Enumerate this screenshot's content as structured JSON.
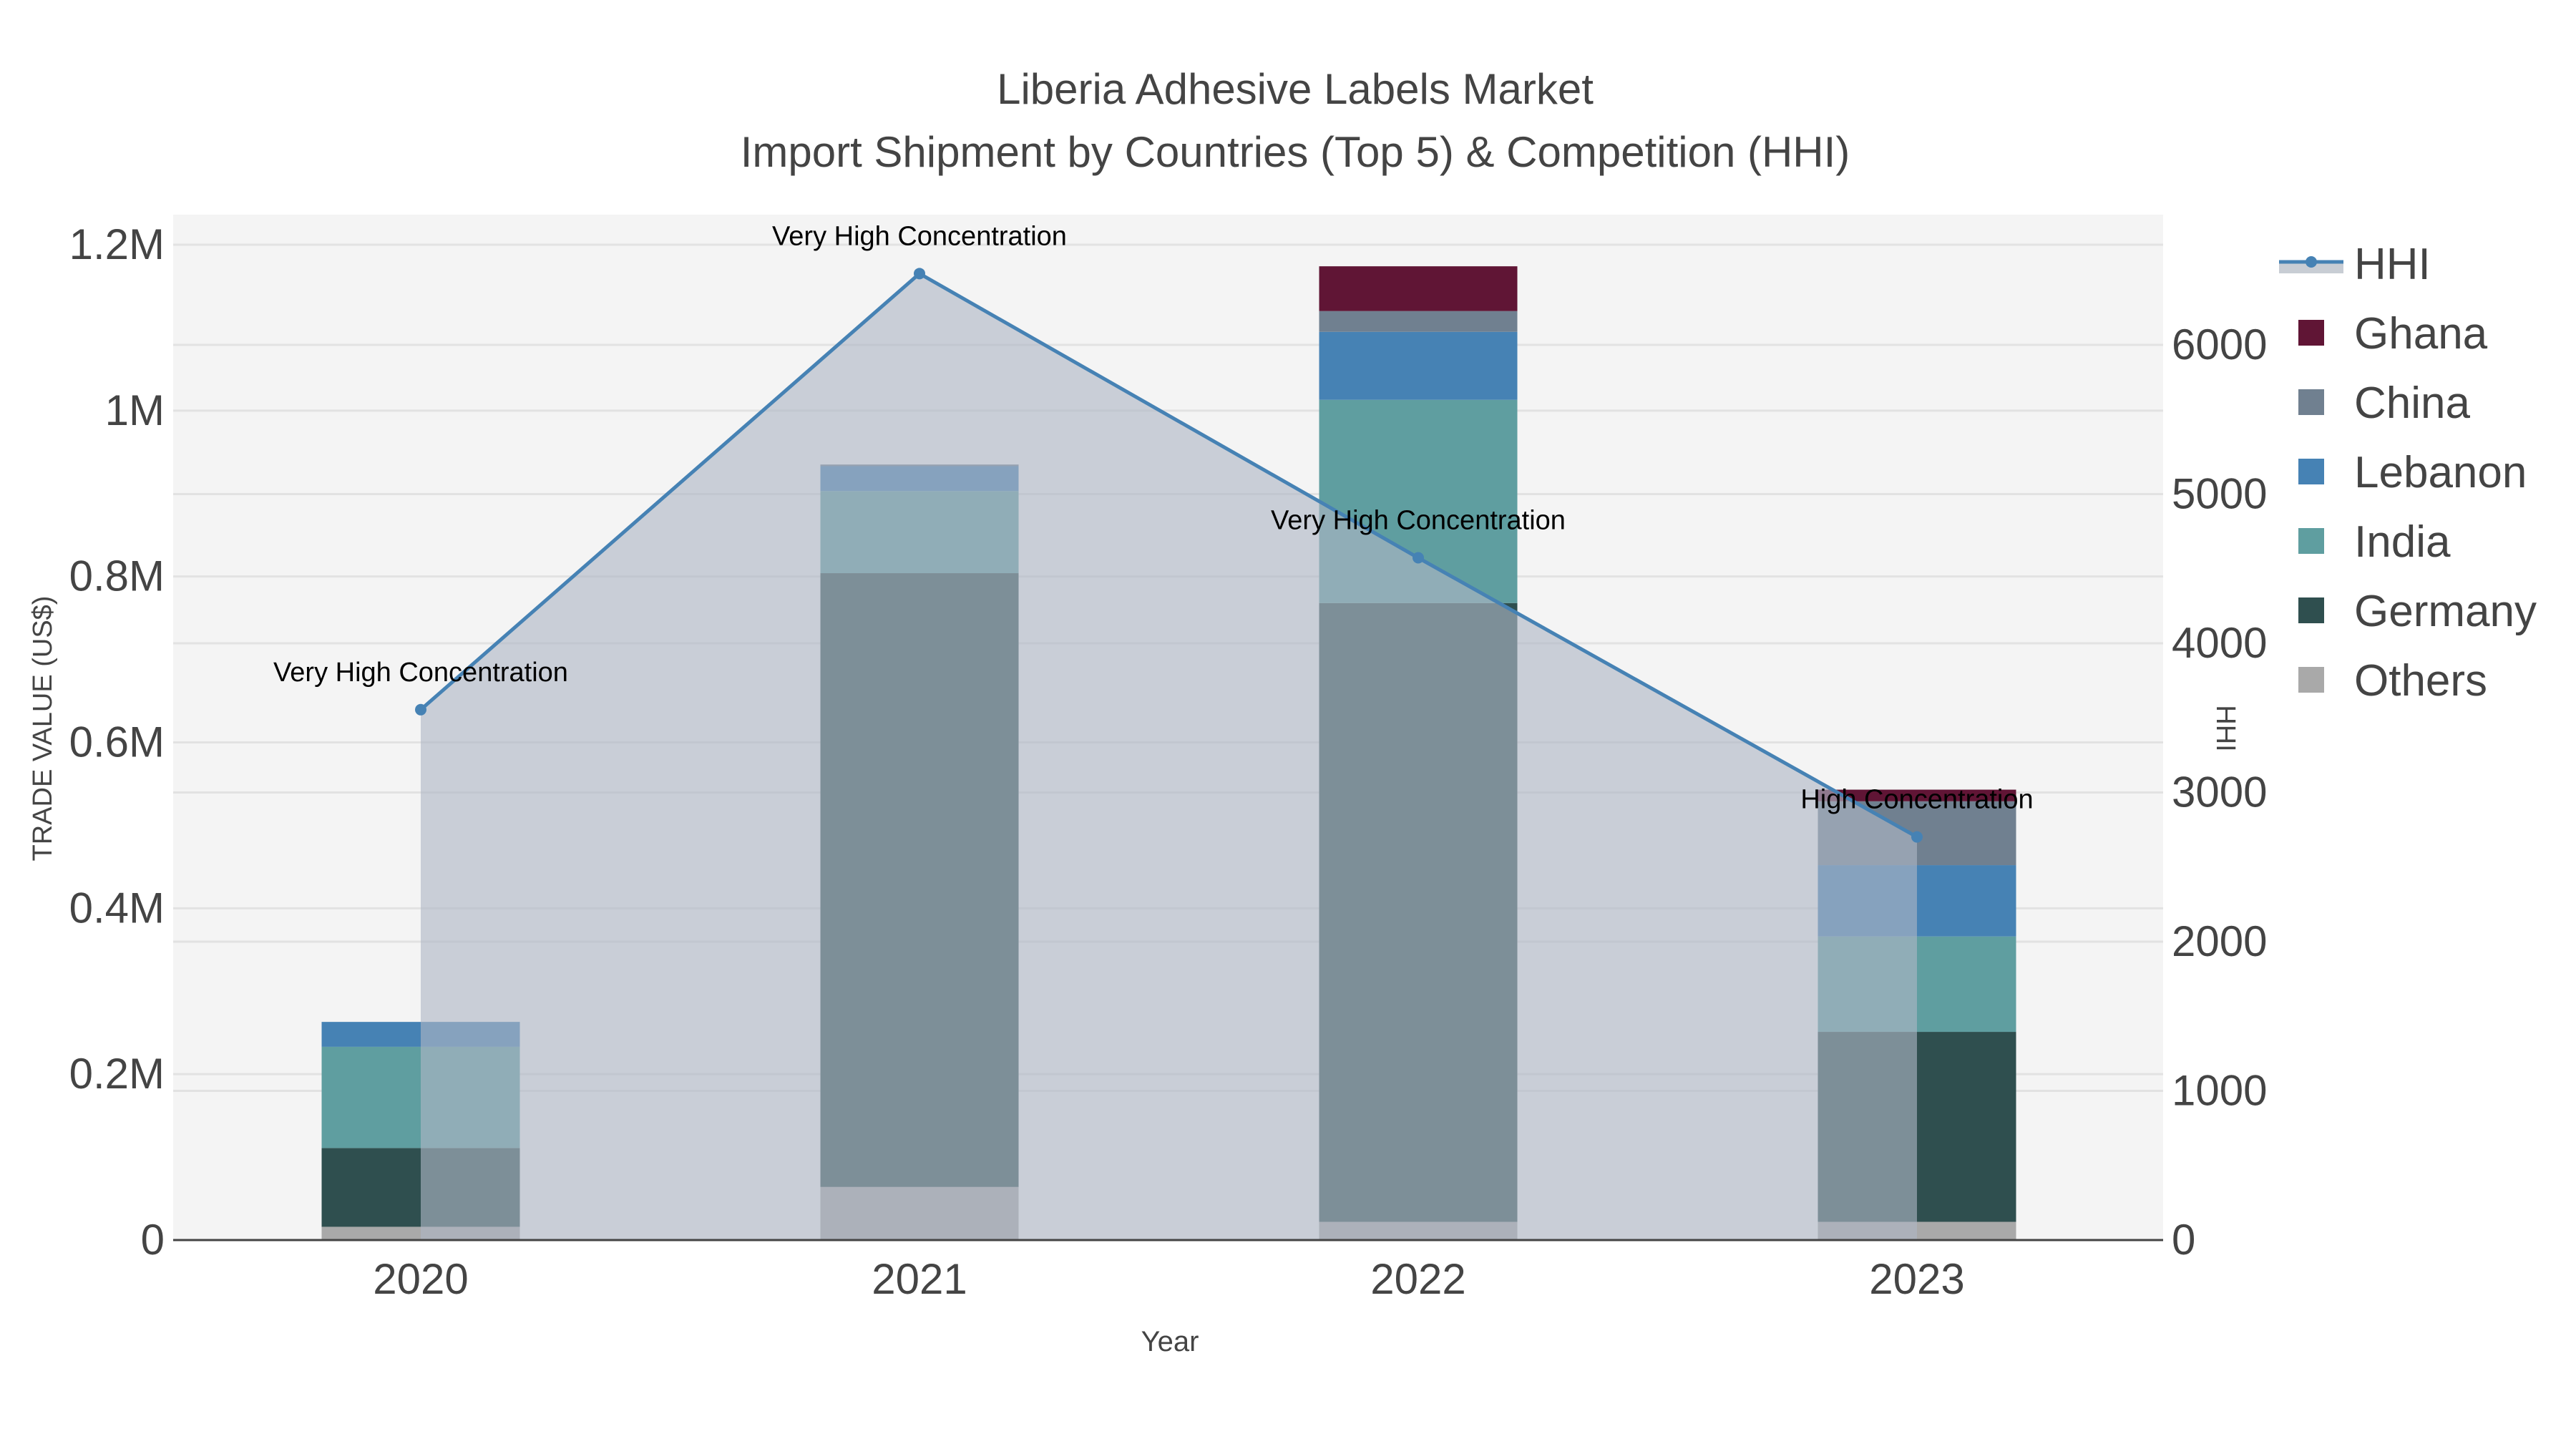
{
  "chart_data": {
    "type": "bar",
    "title": "Liberia Adhesive Labels Market",
    "subtitle": "Import Shipment by Countries (Top 5) & Competition (HHI)",
    "xlabel": "Year",
    "ylabel": "TRADE VALUE (US$)",
    "y2label": "HHI",
    "categories": [
      "2020",
      "2021",
      "2022",
      "2023"
    ],
    "ylim": [
      0,
      1230000
    ],
    "y2lim": [
      0,
      6800
    ],
    "yticks": [
      0,
      200000,
      400000,
      600000,
      800000,
      1000000,
      1200000
    ],
    "ytick_labels": [
      "0",
      "0.2M",
      "0.4M",
      "0.6M",
      "0.8M",
      "1M",
      "1.2M"
    ],
    "y2ticks": [
      0,
      1000,
      2000,
      3000,
      4000,
      5000,
      6000
    ],
    "y2tick_labels": [
      "0",
      "1000",
      "2000",
      "3000",
      "4000",
      "5000",
      "6000"
    ],
    "stacked": true,
    "series": [
      {
        "name": "Others",
        "color": "#A9A9A9",
        "values": [
          16000,
          64000,
          22000,
          22000
        ]
      },
      {
        "name": "Germany",
        "color": "#2F4F4F",
        "values": [
          95000,
          740000,
          746000,
          229000
        ]
      },
      {
        "name": "India",
        "color": "#5F9EA0",
        "values": [
          122000,
          99000,
          245000,
          115000
        ]
      },
      {
        "name": "Lebanon",
        "color": "#4682B4",
        "values": [
          30000,
          30000,
          82000,
          86000
        ]
      },
      {
        "name": "China",
        "color": "#708090",
        "values": [
          0,
          2000,
          25000,
          77000
        ]
      },
      {
        "name": "Ghana",
        "color": "#601535",
        "values": [
          0,
          0,
          54000,
          14000
        ]
      }
    ],
    "line": {
      "name": "HHI",
      "color": "#4682B4",
      "values": [
        3555,
        6478,
        4573,
        2702
      ],
      "annotations": [
        "Very High Concentration",
        "Very High Concentration",
        "Very High Concentration",
        "High Concentration"
      ]
    },
    "legend": {
      "placement": "right",
      "items": [
        "HHI",
        "Ghana",
        "China",
        "Lebanon",
        "India",
        "Germany",
        "Others"
      ]
    },
    "grid": true
  }
}
